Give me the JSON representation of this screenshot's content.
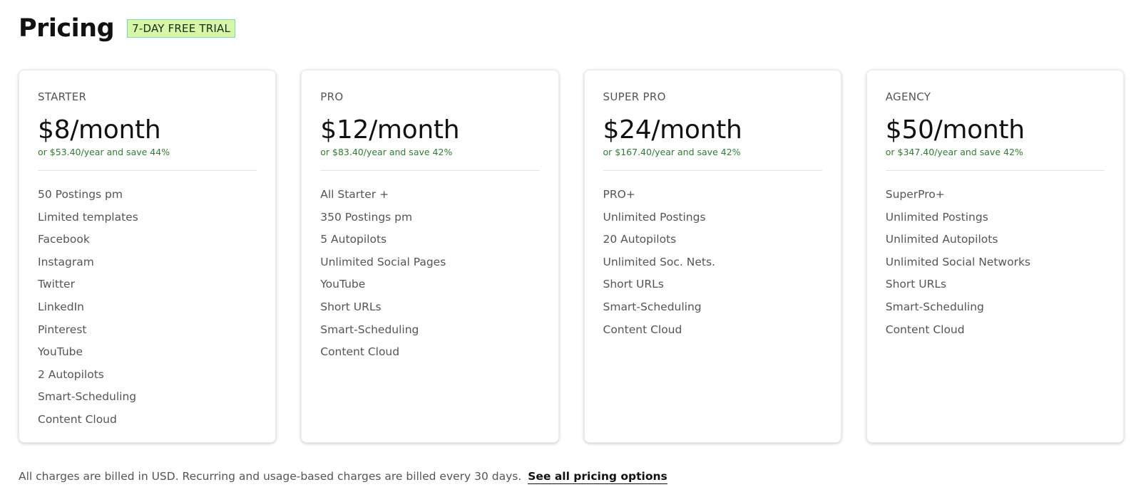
{
  "header": {
    "title": "Pricing",
    "badge": "7-DAY FREE TRIAL"
  },
  "plans": [
    {
      "name": "STARTER",
      "price": "$8/month",
      "annual": "or $53.40/year and save 44%",
      "features": [
        "50 Postings pm",
        "Limited templates",
        "Facebook",
        "Instagram",
        "Twitter",
        "LinkedIn",
        "Pinterest",
        "YouTube",
        "2 Autopilots",
        "Smart-Scheduling",
        "Content Cloud"
      ]
    },
    {
      "name": "PRO",
      "price": "$12/month",
      "annual": "or $83.40/year and save 42%",
      "features": [
        "All Starter +",
        "350 Postings pm",
        "5 Autopilots",
        "Unlimited Social Pages",
        "YouTube",
        "Short URLs",
        "Smart-Scheduling",
        "Content Cloud"
      ]
    },
    {
      "name": "SUPER PRO",
      "price": "$24/month",
      "annual": "or $167.40/year and save 42%",
      "features": [
        "PRO+",
        "Unlimited Postings",
        "20 Autopilots",
        "Unlimited Soc. Nets.",
        "Short URLs",
        "Smart-Scheduling",
        "Content Cloud"
      ]
    },
    {
      "name": "AGENCY",
      "price": "$50/month",
      "annual": "or $347.40/year and save 42%",
      "features": [
        "SuperPro+",
        "Unlimited Postings",
        "Unlimited Autopilots",
        "Unlimited Social Networks",
        "Short URLs",
        "Smart-Scheduling",
        "Content Cloud"
      ]
    }
  ],
  "footer": {
    "text": "All charges are billed in USD. Recurring and usage-based charges are billed every 30 days.",
    "link_label": "See all pricing options"
  },
  "colors": {
    "badge_background": "#d6f7a8",
    "badge_border": "#7fd9a4",
    "annual_text": "#2e7d32"
  }
}
